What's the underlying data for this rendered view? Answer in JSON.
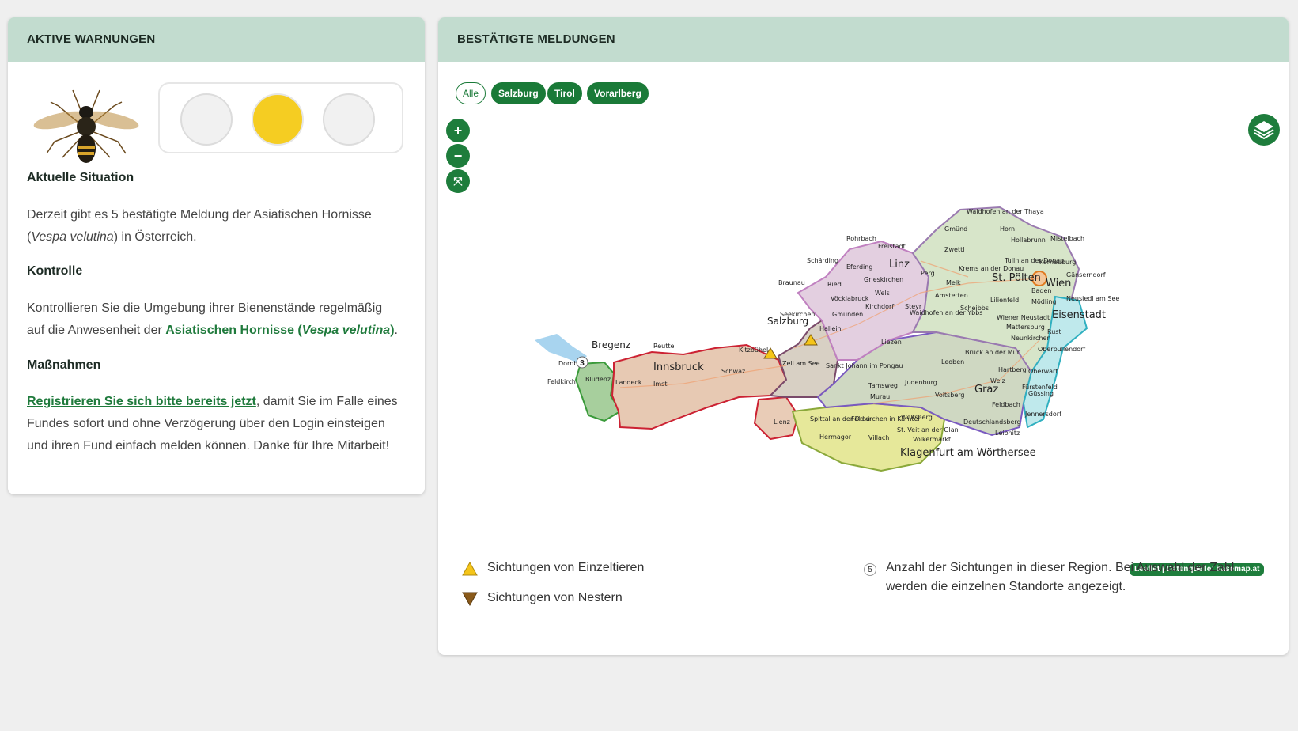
{
  "left_panel": {
    "title": "AKTIVE WARNUNGEN",
    "situation_title": "Aktuelle Situation",
    "situation_text_1": "Derzeit gibt es 5 bestätigte Meldung der Asiatischen Hornisse",
    "situation_open_paren": "(",
    "situation_species": "Vespa velutina",
    "situation_text_2": ") in Österreich.",
    "control_title": "Kontrolle",
    "control_text": "Kontrollieren Sie die Umgebung ihrer Bienenstände regelmäßig auf die Anwesenheit  der ",
    "control_link_a": "Asiatischen Hornisse (",
    "control_link_species": "Vespa velutina",
    "control_link_b": ")",
    "control_end": ".",
    "measures_title": "Maßnahmen",
    "measures_link": "Registrieren Sie sich bitte bereits jetzt",
    "measures_text": ", damit Sie im Falle eines Fundes sofort und ohne Verzögerung über den Login einsteigen und ihren Fund einfach melden können. Danke für Ihre Mitarbeit!",
    "traffic_light": {
      "active": "yellow",
      "colors": {
        "on": "#f5cd22",
        "off": "#f1f1f1"
      }
    }
  },
  "right_panel": {
    "title": "BESTÄTIGTE MELDUNGEN",
    "filters": [
      "Alle",
      "Salzburg",
      "Tirol",
      "Vorarlberg"
    ],
    "map": {
      "zoom_in": "+",
      "zoom_out": "−",
      "fullscreen": "⤧",
      "cluster_count": "3",
      "attribution": "Leaflet | Datenquelle: basemap.at",
      "labels": [
        "Bregenz",
        "Dornbirn",
        "Feldkirch",
        "Bludenz",
        "Reutte",
        "Innsbruck",
        "Landeck",
        "Imst",
        "Schwaz",
        "Kitzbühel",
        "Lienz",
        "Salzburg",
        "Hallein",
        "Zell am See",
        "Sankt Johann im Pongau",
        "Tamsweg",
        "Spittal an der Drau",
        "Hermagor",
        "Feldkirchen in Kärnten",
        "Villach",
        "Wolfsberg",
        "St. Veit an der Glan",
        "Völkermarkt",
        "Klagenfurt am Wörthersee",
        "Murau",
        "Judenburg",
        "Leoben",
        "Bruck an der Mur",
        "Graz",
        "Voitsberg",
        "Weiz",
        "Hartberg",
        "Feldbach",
        "Leibnitz",
        "Deutschlandsberg",
        "Fürstenfeld",
        "Jennersdorf",
        "Güssing",
        "Oberwart",
        "Oberpullendorf",
        "Eisenstadt",
        "Rust",
        "Neusiedl am See",
        "Mattersburg",
        "Wiener Neustadt",
        "Neunkirchen",
        "Baden",
        "Mödling",
        "Wien",
        "St. Pölten",
        "Lilienfeld",
        "Scheibbs",
        "Melk",
        "Amstetten",
        "Waidhofen an der Ybbs",
        "Linz",
        "Wels",
        "Steyr",
        "Kirchdorf",
        "Gmunden",
        "Vöcklabruck",
        "Braunau",
        "Ried",
        "Schärding",
        "Eferding",
        "Grieskirchen",
        "Rohrbach",
        "Freistadt",
        "Perg",
        "Zwettl",
        "Krems an der Donau",
        "Tulln an der Donau",
        "Korneuburg",
        "Gänserndorf",
        "Mistelbach",
        "Hollabrunn",
        "Horn",
        "Gmünd",
        "Waidhofen an der Thaya",
        "Seekirchen",
        "Liezen"
      ]
    },
    "legend": {
      "single": "Sichtungen von Einzeltieren",
      "nests": "Sichtungen von Nestern",
      "count_badge": "5",
      "count_text": "Anzahl der Sichtungen in dieser Region. Bei Auswahl der Zahl werden die einzelnen Standorte angezeigt."
    }
  },
  "colors": {
    "header": "#c2dccf",
    "brand_green": "#1a7a38",
    "single_marker": "#f5c518",
    "nest_marker": "#8a5a1a"
  }
}
